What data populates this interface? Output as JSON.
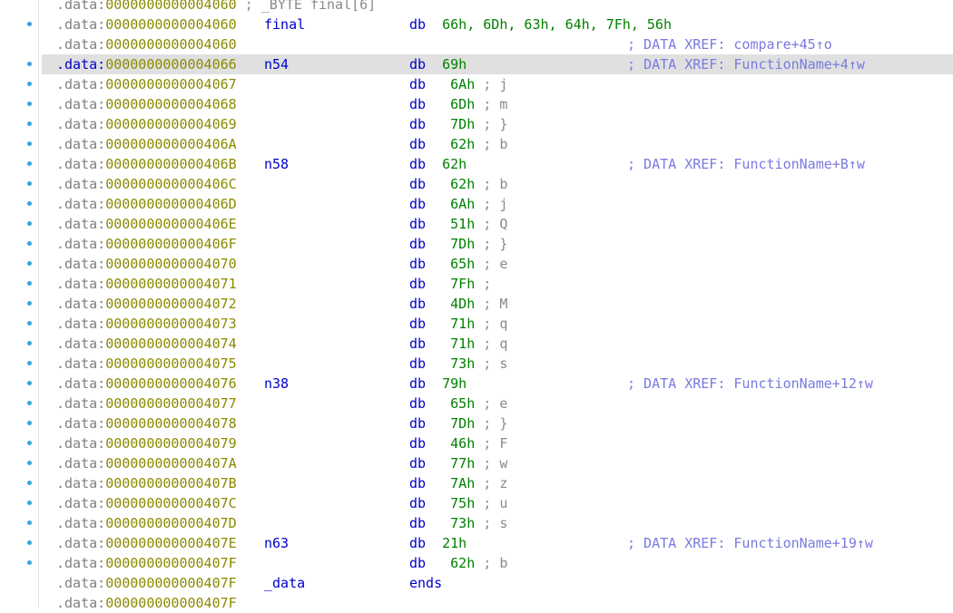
{
  "colors": {
    "address_segment": "#808080",
    "address_offset": "#8a8a00",
    "label": "#0000cc",
    "mnemonic": "#0000cc",
    "operand": "#008000",
    "comment": "#8a8a8a",
    "xref": "#7a7ae0",
    "breakpoint_dot": "#33a6dd",
    "highlight_row": "#e0e0e0"
  },
  "rows": [
    {
      "seg": ".data:",
      "off": "0000000000004060",
      "label": "",
      "inline": " ; _BYTE final[6]",
      "mn": "",
      "ops": "",
      "cmt": "",
      "xref": "",
      "dot": false
    },
    {
      "seg": ".data:",
      "off": "0000000000004060",
      "label": "final",
      "inline": "",
      "mn": "db",
      "ops": "66h, 6Dh, 63h, 64h, 7Fh, 56h",
      "cmt": "",
      "xref": "",
      "dot": true
    },
    {
      "seg": ".data:",
      "off": "0000000000004060",
      "label": "",
      "inline": "",
      "mn": "",
      "ops": "",
      "cmt": "",
      "xref": "; DATA XREF: compare+45↑o",
      "dot": false
    },
    {
      "seg": ".data:",
      "off": "0000000000004066",
      "label": "n54",
      "inline": "",
      "mn": "db",
      "ops": "69h",
      "cmt": "",
      "xref": "; DATA XREF: FunctionName+4↑w",
      "dot": true,
      "highlight": true
    },
    {
      "seg": ".data:",
      "off": "0000000000004067",
      "label": "",
      "inline": "",
      "mn": "db",
      "ops": " 6Ah",
      "cmt": " ; j",
      "xref": "",
      "dot": true
    },
    {
      "seg": ".data:",
      "off": "0000000000004068",
      "label": "",
      "inline": "",
      "mn": "db",
      "ops": " 6Dh",
      "cmt": " ; m",
      "xref": "",
      "dot": true
    },
    {
      "seg": ".data:",
      "off": "0000000000004069",
      "label": "",
      "inline": "",
      "mn": "db",
      "ops": " 7Dh",
      "cmt": " ; }",
      "xref": "",
      "dot": true
    },
    {
      "seg": ".data:",
      "off": "000000000000406A",
      "label": "",
      "inline": "",
      "mn": "db",
      "ops": " 62h",
      "cmt": " ; b",
      "xref": "",
      "dot": true
    },
    {
      "seg": ".data:",
      "off": "000000000000406B",
      "label": "n58",
      "inline": "",
      "mn": "db",
      "ops": "62h",
      "cmt": "",
      "xref": "; DATA XREF: FunctionName+B↑w",
      "dot": true
    },
    {
      "seg": ".data:",
      "off": "000000000000406C",
      "label": "",
      "inline": "",
      "mn": "db",
      "ops": " 62h",
      "cmt": " ; b",
      "xref": "",
      "dot": true
    },
    {
      "seg": ".data:",
      "off": "000000000000406D",
      "label": "",
      "inline": "",
      "mn": "db",
      "ops": " 6Ah",
      "cmt": " ; j",
      "xref": "",
      "dot": true
    },
    {
      "seg": ".data:",
      "off": "000000000000406E",
      "label": "",
      "inline": "",
      "mn": "db",
      "ops": " 51h",
      "cmt": " ; Q",
      "xref": "",
      "dot": true
    },
    {
      "seg": ".data:",
      "off": "000000000000406F",
      "label": "",
      "inline": "",
      "mn": "db",
      "ops": " 7Dh",
      "cmt": " ; }",
      "xref": "",
      "dot": true
    },
    {
      "seg": ".data:",
      "off": "0000000000004070",
      "label": "",
      "inline": "",
      "mn": "db",
      "ops": " 65h",
      "cmt": " ; e",
      "xref": "",
      "dot": true
    },
    {
      "seg": ".data:",
      "off": "0000000000004071",
      "label": "",
      "inline": "",
      "mn": "db",
      "ops": " 7Fh",
      "cmt": " ;",
      "xref": "",
      "dot": true
    },
    {
      "seg": ".data:",
      "off": "0000000000004072",
      "label": "",
      "inline": "",
      "mn": "db",
      "ops": " 4Dh",
      "cmt": " ; M",
      "xref": "",
      "dot": true
    },
    {
      "seg": ".data:",
      "off": "0000000000004073",
      "label": "",
      "inline": "",
      "mn": "db",
      "ops": " 71h",
      "cmt": " ; q",
      "xref": "",
      "dot": true
    },
    {
      "seg": ".data:",
      "off": "0000000000004074",
      "label": "",
      "inline": "",
      "mn": "db",
      "ops": " 71h",
      "cmt": " ; q",
      "xref": "",
      "dot": true
    },
    {
      "seg": ".data:",
      "off": "0000000000004075",
      "label": "",
      "inline": "",
      "mn": "db",
      "ops": " 73h",
      "cmt": " ; s",
      "xref": "",
      "dot": true
    },
    {
      "seg": ".data:",
      "off": "0000000000004076",
      "label": "n38",
      "inline": "",
      "mn": "db",
      "ops": "79h",
      "cmt": "",
      "xref": "; DATA XREF: FunctionName+12↑w",
      "dot": true
    },
    {
      "seg": ".data:",
      "off": "0000000000004077",
      "label": "",
      "inline": "",
      "mn": "db",
      "ops": " 65h",
      "cmt": " ; e",
      "xref": "",
      "dot": true
    },
    {
      "seg": ".data:",
      "off": "0000000000004078",
      "label": "",
      "inline": "",
      "mn": "db",
      "ops": " 7Dh",
      "cmt": " ; }",
      "xref": "",
      "dot": true
    },
    {
      "seg": ".data:",
      "off": "0000000000004079",
      "label": "",
      "inline": "",
      "mn": "db",
      "ops": " 46h",
      "cmt": " ; F",
      "xref": "",
      "dot": true
    },
    {
      "seg": ".data:",
      "off": "000000000000407A",
      "label": "",
      "inline": "",
      "mn": "db",
      "ops": " 77h",
      "cmt": " ; w",
      "xref": "",
      "dot": true
    },
    {
      "seg": ".data:",
      "off": "000000000000407B",
      "label": "",
      "inline": "",
      "mn": "db",
      "ops": " 7Ah",
      "cmt": " ; z",
      "xref": "",
      "dot": true
    },
    {
      "seg": ".data:",
      "off": "000000000000407C",
      "label": "",
      "inline": "",
      "mn": "db",
      "ops": " 75h",
      "cmt": " ; u",
      "xref": "",
      "dot": true
    },
    {
      "seg": ".data:",
      "off": "000000000000407D",
      "label": "",
      "inline": "",
      "mn": "db",
      "ops": " 73h",
      "cmt": " ; s",
      "xref": "",
      "dot": true
    },
    {
      "seg": ".data:",
      "off": "000000000000407E",
      "label": "n63",
      "inline": "",
      "mn": "db",
      "ops": "21h",
      "cmt": "",
      "xref": "; DATA XREF: FunctionName+19↑w",
      "dot": true
    },
    {
      "seg": ".data:",
      "off": "000000000000407F",
      "label": "",
      "inline": "",
      "mn": "db",
      "ops": " 62h",
      "cmt": " ; b",
      "xref": "",
      "dot": true
    },
    {
      "seg": ".data:",
      "off": "000000000000407F",
      "label": "_data",
      "inline": "",
      "mn": "ends",
      "ops": "",
      "cmt": "",
      "xref": "",
      "dot": false
    },
    {
      "seg": ".data:",
      "off": "000000000000407F",
      "label": "",
      "inline": "",
      "mn": "",
      "ops": "",
      "cmt": "",
      "xref": "",
      "dot": false
    }
  ]
}
